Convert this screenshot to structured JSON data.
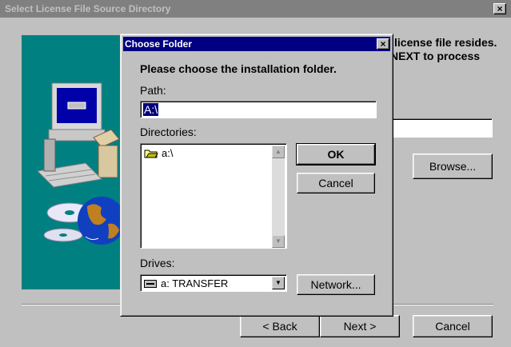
{
  "outer": {
    "title": "Select License File Source Directory",
    "instruction_line1": "license file resides.",
    "instruction_line2": "NEXT to process",
    "browse_label": "Browse...",
    "back_label": "< Back",
    "next_label": "Next >",
    "cancel_label": "Cancel"
  },
  "dialog": {
    "title": "Choose Folder",
    "prompt": "Please choose the installation folder.",
    "path_label": "Path:",
    "path_value": "A:\\",
    "directories_label": "Directories:",
    "directories": [
      "a:\\"
    ],
    "drives_label": "Drives:",
    "drive_selected": "a: TRANSFER",
    "ok_label": "OK",
    "cancel_label": "Cancel",
    "network_label": "Network..."
  },
  "icons": {
    "folder": "open-folder-icon",
    "drive": "floppy-drive-icon",
    "close": "close-icon",
    "dropdown": "chevron-down-icon"
  },
  "colors": {
    "title_active": "#000080",
    "title_inactive": "#808080",
    "window_bg": "#c0c0c0",
    "teal_panel": "#008080"
  }
}
